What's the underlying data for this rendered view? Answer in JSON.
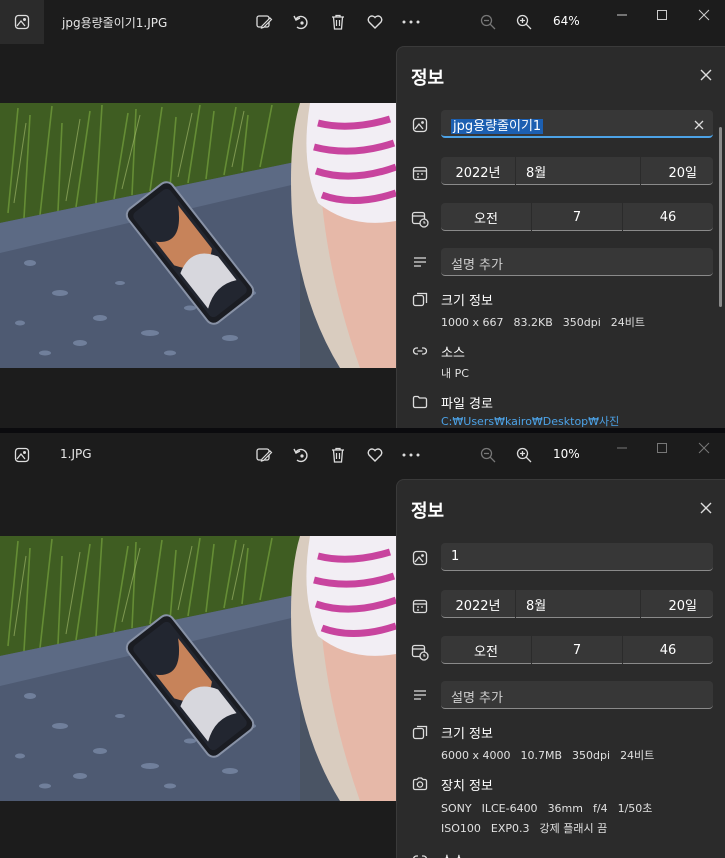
{
  "windows": [
    {
      "filename": "jpg용량줄이기1.JPG",
      "zoom": "64%",
      "info_title": "정보",
      "name_value": "jpg용량줄이기1",
      "date": {
        "year": "2022년",
        "month": "8월",
        "day": "20일"
      },
      "time": {
        "ampm": "오전",
        "hour": "7",
        "minute": "46"
      },
      "description_placeholder": "설명 추가",
      "size_label": "크기 정보",
      "size_values": [
        "1000 x 667",
        "83.2KB",
        "350dpi",
        "24비트"
      ],
      "source_label": "소스",
      "source_value": "내 PC",
      "path_label": "파일 경로",
      "path_value": "C:₩Users₩kairo₩Desktop₩사진"
    },
    {
      "filename": "1.JPG",
      "zoom": "10%",
      "info_title": "정보",
      "name_value": "1",
      "date": {
        "year": "2022년",
        "month": "8월",
        "day": "20일"
      },
      "time": {
        "ampm": "오전",
        "hour": "7",
        "minute": "46"
      },
      "description_placeholder": "설명 추가",
      "size_label": "크기 정보",
      "size_values": [
        "6000 x 4000",
        "10.7MB",
        "350dpi",
        "24비트"
      ],
      "device_label": "장치 정보",
      "device_values_1": [
        "SONY",
        "ILCE-6400",
        "36mm",
        "f/4",
        "1/50초"
      ],
      "device_values_2": [
        "ISO100",
        "EXP0.3",
        "강제 플래시 끔"
      ],
      "source_label": "소스"
    }
  ],
  "colors": {
    "background": "#1c1c1c",
    "panel": "#2b2b2b",
    "field": "#373737",
    "accent": "#4ca2e6",
    "selection": "#1c5fb1"
  }
}
